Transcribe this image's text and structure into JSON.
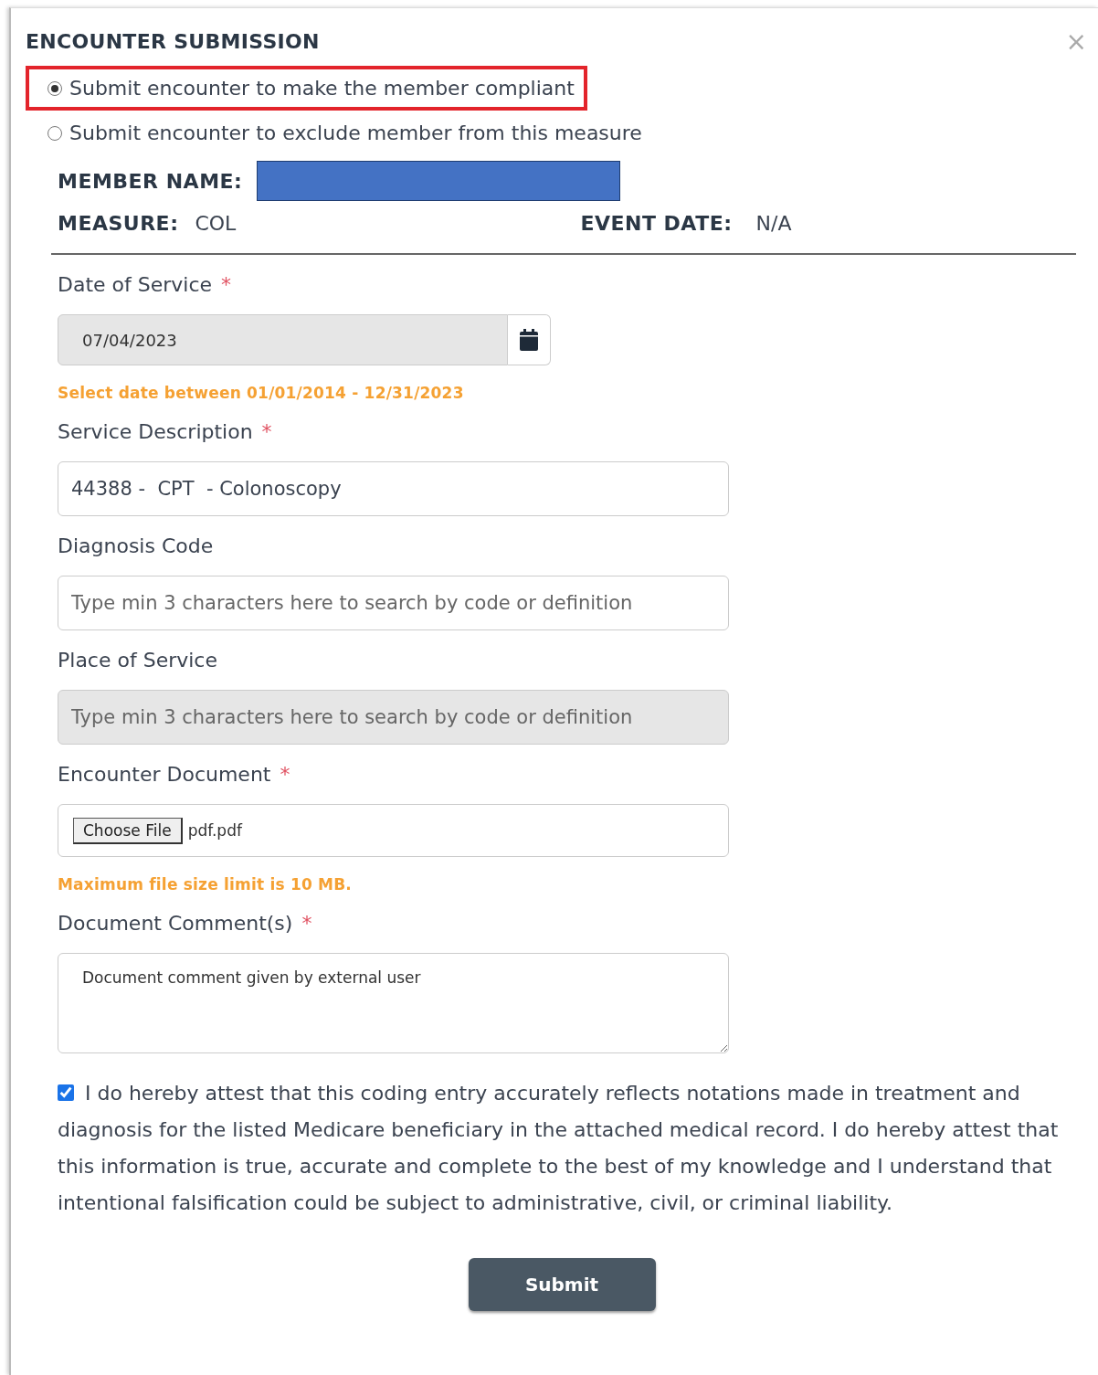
{
  "dialog": {
    "title": "ENCOUNTER SUBMISSION",
    "close": "×"
  },
  "options": [
    {
      "label": "Submit encounter to make the member compliant",
      "selected": true,
      "highlighted": true
    },
    {
      "label": "Submit encounter to exclude member from this measure",
      "selected": false,
      "highlighted": false
    }
  ],
  "member": {
    "name_label": "MEMBER NAME:",
    "name_redacted": true,
    "measure_label": "MEASURE:",
    "measure": "COL",
    "event_date_label": "EVENT DATE:",
    "event_date": "N/A"
  },
  "fields": [
    {
      "kind": "date",
      "label": "Date of Service",
      "required_mark": "*",
      "value": "07/04/2023",
      "disabled": true,
      "hint": "Select date between 01/01/2014 - 12/31/2023"
    },
    {
      "kind": "text",
      "label": "Service Description",
      "required_mark": "*",
      "value": "44388 -  CPT  - Colonoscopy",
      "disabled": false
    },
    {
      "kind": "text",
      "label": "Diagnosis Code",
      "placeholder": "Type min 3 characters here to search by code or definition",
      "disabled": false
    },
    {
      "kind": "text",
      "label": "Place of Service",
      "placeholder": "Type min 3 characters here to search by code or definition",
      "disabled": true
    },
    {
      "kind": "file",
      "label": "Encounter Document",
      "required_mark": "*",
      "button": "Choose File",
      "value": "pdf.pdf",
      "disabled": false,
      "hint": "Maximum file size limit is 10 MB."
    },
    {
      "kind": "textarea",
      "label": "Document Comment(s)",
      "required_mark": "*",
      "value": "Document comment given by external user",
      "disabled": false
    }
  ],
  "attestation": {
    "checked": true,
    "text": "I do hereby attest that this coding entry accurately reflects notations made in treatment and diagnosis for the listed Medicare beneficiary in the attached medical record. I do hereby attest that this information is true, accurate and complete to the best of my knowledge and I understand that intentional falsification could be subject to administrative, civil, or criminal liability."
  },
  "submit": "Submit"
}
